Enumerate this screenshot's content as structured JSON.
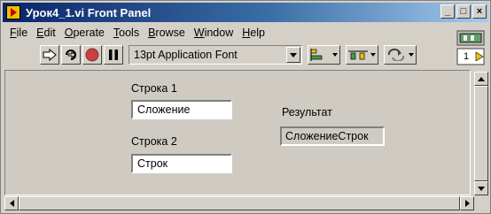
{
  "window": {
    "title": "Урок4_1.vi Front Panel",
    "buttons": {
      "minimize": "_",
      "maximize": "□",
      "close": "×"
    }
  },
  "menu": [
    {
      "key": "F",
      "rest": "ile"
    },
    {
      "key": "E",
      "rest": "dit"
    },
    {
      "key": "O",
      "rest": "perate"
    },
    {
      "key": "T",
      "rest": "ools"
    },
    {
      "key": "B",
      "rest": "rowse"
    },
    {
      "key": "W",
      "rest": "indow"
    },
    {
      "key": "H",
      "rest": "elp"
    }
  ],
  "toolbar": {
    "run_icon": "run-arrow-icon",
    "run_continuously_icon": "run-continuously-icon",
    "abort_icon": "abort-stop-icon",
    "pause_icon": "pause-icon",
    "font_label": "13pt Application Font",
    "align_icon": "align-objects-icon",
    "distribute_icon": "distribute-objects-icon",
    "reorder_icon": "reorder-icon"
  },
  "connector": {
    "terminal_number": "1"
  },
  "panel": {
    "string1": {
      "label": "Строка 1",
      "value": "Сложение"
    },
    "string2": {
      "label": "Строка 2",
      "value": "Строк"
    },
    "result": {
      "label": "Результат",
      "value": "СложениеСтрок"
    }
  },
  "colors": {
    "title_start": "#0a246a",
    "title_end": "#a6caf0",
    "panel_bg": "#cfcbc3",
    "abort_red": "#c84040"
  }
}
